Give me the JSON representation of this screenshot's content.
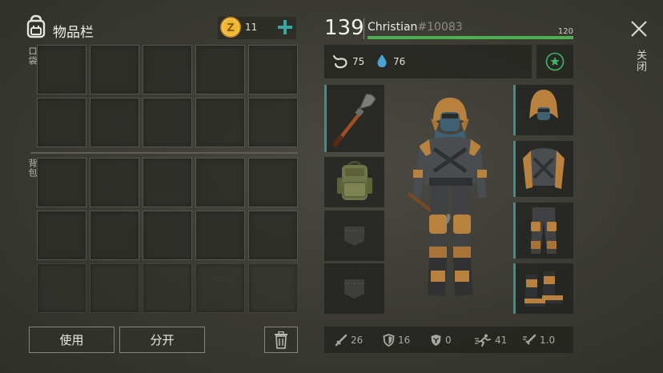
{
  "inventory": {
    "title": "物品栏",
    "coins": "11",
    "pocket_label": "口袋",
    "backpack_label": "背包",
    "use_button": "使用",
    "split_button": "分开"
  },
  "player": {
    "level": "139",
    "name": "Christian",
    "id": "#10083",
    "xp_max": "120",
    "xp_fraction": 1.0,
    "food": "75",
    "water": "76"
  },
  "close_label": "关闭",
  "stats": {
    "attack": "26",
    "defense": "16",
    "radiation": "0",
    "speed": "41",
    "weight": "1.0"
  },
  "colors": {
    "accent": "#3e8f8c",
    "xp_bar": "#4caf50",
    "coin": "#e0a520"
  },
  "icons": {
    "backpack": "backpack-icon",
    "coin": "coin-icon",
    "add": "plus-icon",
    "close": "close-icon",
    "trash": "trash-icon",
    "stomach": "stomach-icon",
    "water": "water-drop-icon",
    "star": "star-icon"
  }
}
